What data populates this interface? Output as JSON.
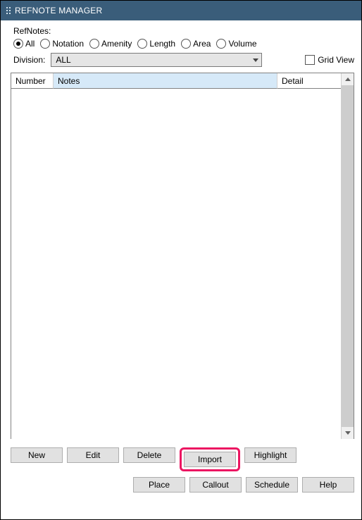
{
  "window": {
    "title": "REFNOTE MANAGER"
  },
  "section": {
    "refnotes_label": "RefNotes:"
  },
  "radios": {
    "all": "All",
    "notation": "Notation",
    "amenity": "Amenity",
    "length": "Length",
    "area": "Area",
    "volume": "Volume"
  },
  "division": {
    "label": "Division:",
    "value": "ALL"
  },
  "gridview": {
    "label": "Grid View"
  },
  "columns": {
    "number": "Number",
    "notes": "Notes",
    "detail": "Detail"
  },
  "buttons_row1": {
    "new": "New",
    "edit": "Edit",
    "delete": "Delete",
    "import": "Import",
    "highlight": "Highlight"
  },
  "buttons_row2": {
    "place": "Place",
    "callout": "Callout",
    "schedule": "Schedule",
    "help": "Help"
  }
}
